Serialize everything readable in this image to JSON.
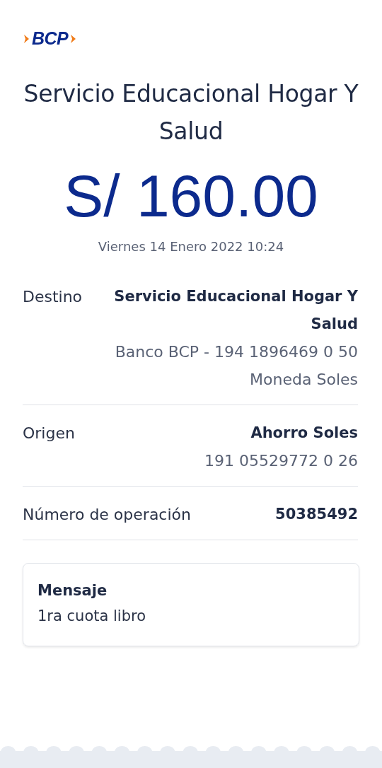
{
  "logo": {
    "text": "BCP"
  },
  "title": "Servicio Educacional Hogar Y Salud",
  "amount": "S/ 160.00",
  "date": "Viernes 14 Enero 2022 10:24",
  "details": [
    {
      "label": "Destino",
      "lines": [
        "Servicio Educacional Hogar Y Salud",
        "Banco BCP - 194 1896469 0 50",
        "Moneda Soles"
      ]
    },
    {
      "label": "Origen",
      "lines": [
        "Ahorro Soles",
        "191 05529772 0 26"
      ]
    },
    {
      "label": "Número de operación",
      "lines": [
        "50385492"
      ]
    }
  ],
  "message": {
    "title": "Mensaje",
    "text": "1ra cuota libro"
  }
}
